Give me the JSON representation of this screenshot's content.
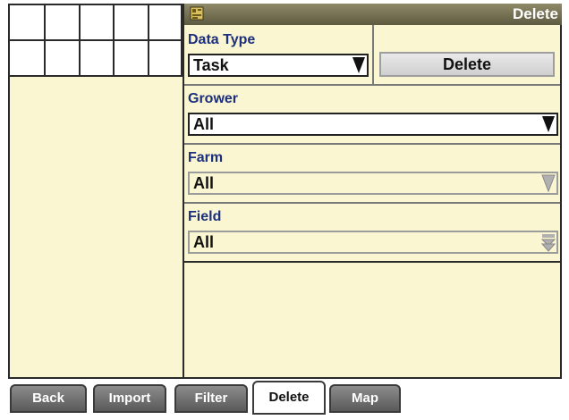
{
  "header": {
    "title": "Delete",
    "icon": "data-icon"
  },
  "data_type": {
    "label": "Data Type",
    "value": "Task"
  },
  "delete_button": {
    "label": "Delete"
  },
  "grower": {
    "label": "Grower",
    "value": "All"
  },
  "farm": {
    "label": "Farm",
    "value": "All"
  },
  "field": {
    "label": "Field",
    "value": "All"
  },
  "tabs": [
    {
      "label": "Back"
    },
    {
      "label": "Import"
    },
    {
      "label": "Filter"
    },
    {
      "label": "Delete",
      "active": true
    },
    {
      "label": "Map"
    }
  ],
  "colors": {
    "panel_bg": "#fbf6d2",
    "label_text": "#1c2f7c",
    "titlebar": "#6f6a4d"
  }
}
